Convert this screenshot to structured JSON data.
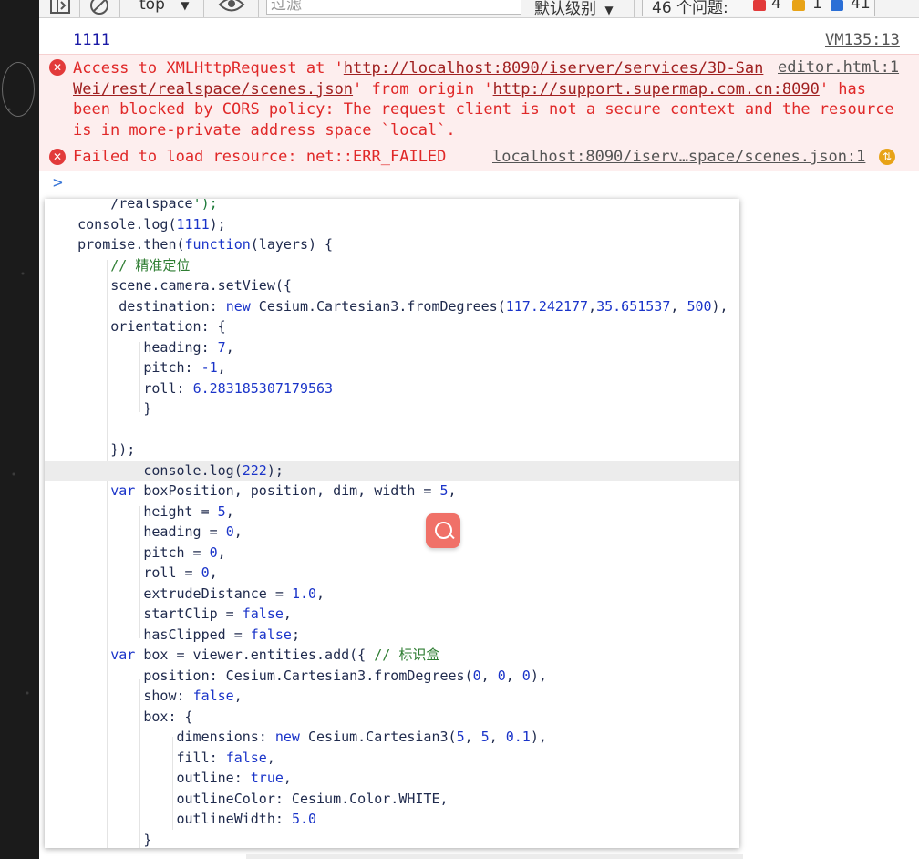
{
  "toolbar": {
    "context": "top",
    "filter_placeholder": "过滤",
    "level": "默认级别",
    "issues_label": "46 个问题:",
    "error_count": "4",
    "warning_count": "1",
    "info_count": "41"
  },
  "console": {
    "log_value": "1111",
    "log_source": "VM135:13",
    "error1": {
      "source": "editor.html:1",
      "text_prefix": "Access to XMLHttpRequest at '",
      "url1": "http://localhost:8090/iserver/services/3D-SanWei/rest/realspace/scenes.json",
      "url1_part1": "http://localhost:8090/iserver/services/3D-San",
      "url1_part2": "Wei/rest/realspace/scenes.json",
      "text_mid": "' from origin '",
      "url2": "http://support.supermap.com.cn:8090",
      "text_suffix1": "' has",
      "line3": "been blocked by CORS policy: The request client is not a secure context and the resource",
      "line4": "is in more-private address space `local`."
    },
    "error2": {
      "text": "Failed to load resource: net::ERR_FAILED",
      "source": "localhost:8090/iserv…space/scenes.json:1"
    },
    "prompt": ">"
  },
  "code_lines": [
    "        /realspace');",
    "    console.log(1111);",
    "    promise.then(function(layers) {",
    "        // 精准定位",
    "        scene.camera.setView({",
    "         destination: new Cesium.Cartesian3.fromDegrees(117.242177,35.651537, 500),",
    "        orientation: {",
    "            heading: 7,",
    "            pitch: -1,",
    "            roll: 6.283185307179563",
    "            }",
    "",
    "        });",
    "            console.log(222);",
    "        var boxPosition, position, dim, width = 5,",
    "            height = 5,",
    "            heading = 0,",
    "            pitch = 0,",
    "            roll = 0,",
    "            extrudeDistance = 1.0,",
    "            startClip = false,",
    "            hasClipped = false;",
    "        var box = viewer.entities.add({ // 标识盒",
    "            position: Cesium.Cartesian3.fromDegrees(0, 0, 0),",
    "            show: false,",
    "            box: {",
    "                dimensions: new Cesium.Cartesian3(5, 5, 0.1),",
    "                fill: false,",
    "                outline: true,",
    "                outlineColor: Cesium.Color.WHITE,",
    "                outlineWidth: 5.0",
    "            }"
  ],
  "colors": {
    "error_red": "#e02828",
    "error_bg": "#fdeeee",
    "log_blue": "#1a1aa6",
    "keyword_blue": "#1a34c9",
    "comment_green": "#2e7d32"
  },
  "icons": [
    "sidebar-toggle-icon",
    "clear-console-icon",
    "dropdown-arrow-icon",
    "eye-icon",
    "error-icon",
    "warning-icon",
    "info-icon",
    "prompt-chevron-icon",
    "search-magnifier-icon",
    "network-request-icon"
  ]
}
